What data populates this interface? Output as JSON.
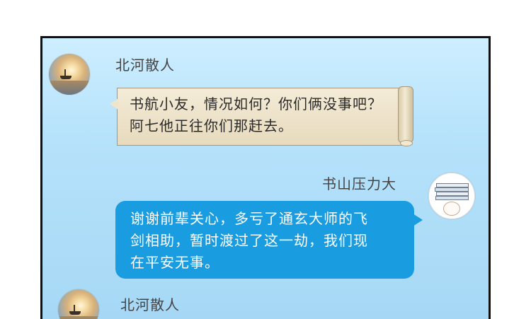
{
  "messages": [
    {
      "sender": "北河散人",
      "lines": [
        "书航小友，情况如何？你们俩没事吧？",
        "阿七他正往你们那赶去。"
      ]
    },
    {
      "sender": "书山压力大",
      "lines": [
        "谢谢前辈关心，多亏了通玄大师的飞",
        "剑相助，暂时渡过了这一劫，我们现",
        "在平安无事。"
      ]
    },
    {
      "sender": "北河散人"
    }
  ],
  "colors": {
    "background": "#b6e2fb",
    "outgoing_bubble": "#1a9de0",
    "incoming_bubble": "#efe5cd"
  },
  "avatars": [
    "sunset-boat-avatar",
    "book-stack-avatar",
    "sunset-boat-avatar"
  ]
}
